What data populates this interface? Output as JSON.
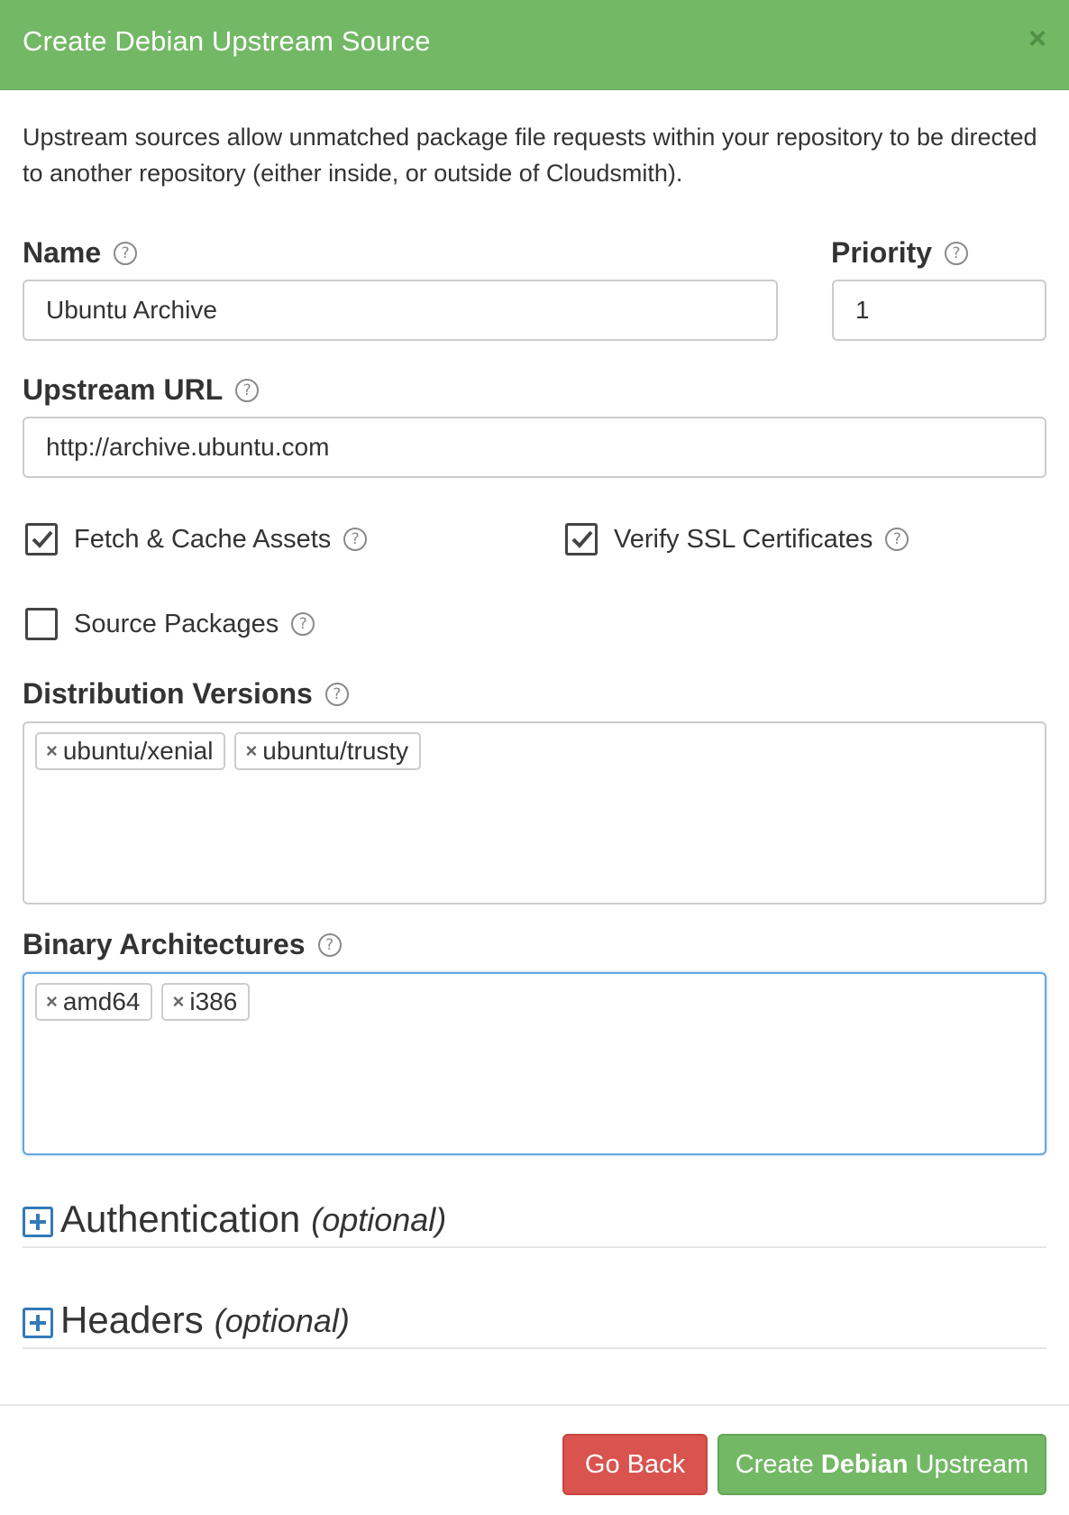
{
  "modal": {
    "title": "Create Debian Upstream Source",
    "close_glyph": "×",
    "intro": "Upstream sources allow unmatched package file requests within your repository to be directed to another repository (either inside, or outside of Cloudsmith)."
  },
  "fields": {
    "name": {
      "label": "Name",
      "value": "Ubuntu Archive"
    },
    "priority": {
      "label": "Priority",
      "value": "1"
    },
    "upstream_url": {
      "label": "Upstream URL",
      "value": "http://archive.ubuntu.com"
    }
  },
  "checkboxes": {
    "fetch_cache": {
      "label": "Fetch & Cache Assets",
      "checked": true
    },
    "verify_ssl": {
      "label": "Verify SSL Certificates",
      "checked": true
    },
    "source_packages": {
      "label": "Source Packages",
      "checked": false
    }
  },
  "distribution_versions": {
    "label": "Distribution Versions",
    "tags": [
      "ubuntu/xenial",
      "ubuntu/trusty"
    ]
  },
  "binary_architectures": {
    "label": "Binary Architectures",
    "tags": [
      "amd64",
      "i386"
    ]
  },
  "sections": {
    "authentication": {
      "title": "Authentication",
      "optional": "(optional)"
    },
    "headers": {
      "title": "Headers",
      "optional": "(optional)"
    }
  },
  "buttons": {
    "back": "Go Back",
    "create_prefix": "Create",
    "create_bold": "Debian",
    "create_suffix": "Upstream"
  },
  "help_glyph": "?",
  "tag_remove_glyph": "×",
  "colors": {
    "header": "#73b865",
    "danger": "#d9534f",
    "success": "#73b865",
    "focus": "#66a5de",
    "link": "#337ab7"
  }
}
